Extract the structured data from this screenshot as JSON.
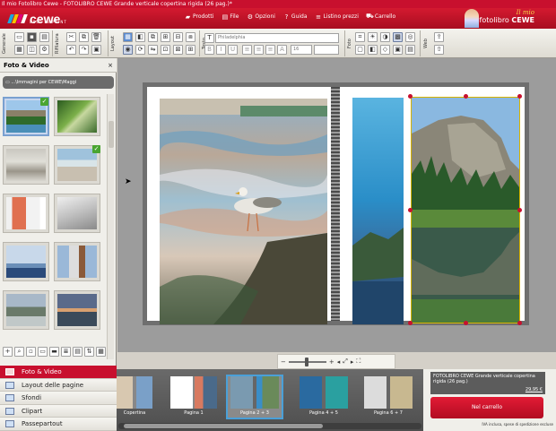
{
  "window": {
    "title": "Il mio Fotolibro Cewe - FOTOLIBRO CEWE Grande verticale copertina rigida (26 pag.)*"
  },
  "brand": {
    "logo": "cewe",
    "tagline": "BEST IN PRINT",
    "il_mio": "Il mio",
    "product_prefix": "fotolibro",
    "product_brand": "CEWE",
    "colors": {
      "accent": "#c8102e",
      "gold": "#f7d24a"
    }
  },
  "menu": [
    {
      "label": "Prodotti",
      "icon": "cart-icon"
    },
    {
      "label": "File",
      "icon": "folder-icon"
    },
    {
      "label": "Opzioni",
      "icon": "gear-icon"
    },
    {
      "label": "Guida",
      "icon": "help-icon"
    },
    {
      "label": "Listino prezzi",
      "icon": "price-list-icon"
    },
    {
      "label": "Carrello",
      "icon": "shopping-cart-icon"
    }
  ],
  "toolbar": {
    "groups": [
      "Generale",
      "Rifilatura",
      "Layout",
      "Testo",
      "Foto",
      "Web"
    ],
    "font_placeholder": "Philadelphia",
    "font_size": "16"
  },
  "left_panel": {
    "title": "Foto & Video",
    "close": "×",
    "folder_path": "...\\Immagini per CEWE\\Maggi",
    "nav": [
      {
        "label": "Foto & Video",
        "active": true
      },
      {
        "label": "Layout delle pagine",
        "active": false
      },
      {
        "label": "Sfondi",
        "active": false
      },
      {
        "label": "Clipart",
        "active": false
      },
      {
        "label": "Passepartout",
        "active": false
      }
    ]
  },
  "zoom": {
    "zoom_out": "−",
    "zoom_in": "+"
  },
  "page_strip": [
    {
      "label": "Copertina"
    },
    {
      "label": "Pagina 1"
    },
    {
      "label": "Pagina 2 + 3",
      "selected": true
    },
    {
      "label": "Pagina 4 + 5"
    },
    {
      "label": "Pagina 6 + 7"
    }
  ],
  "cart": {
    "product": "FOTOLIBRO CEWE Grande verticale copertina rigida (26 pag.)",
    "price": "29,95 €",
    "button": "Nel carrello",
    "note": "IVA inclusa, spese di spedizione escluse"
  }
}
